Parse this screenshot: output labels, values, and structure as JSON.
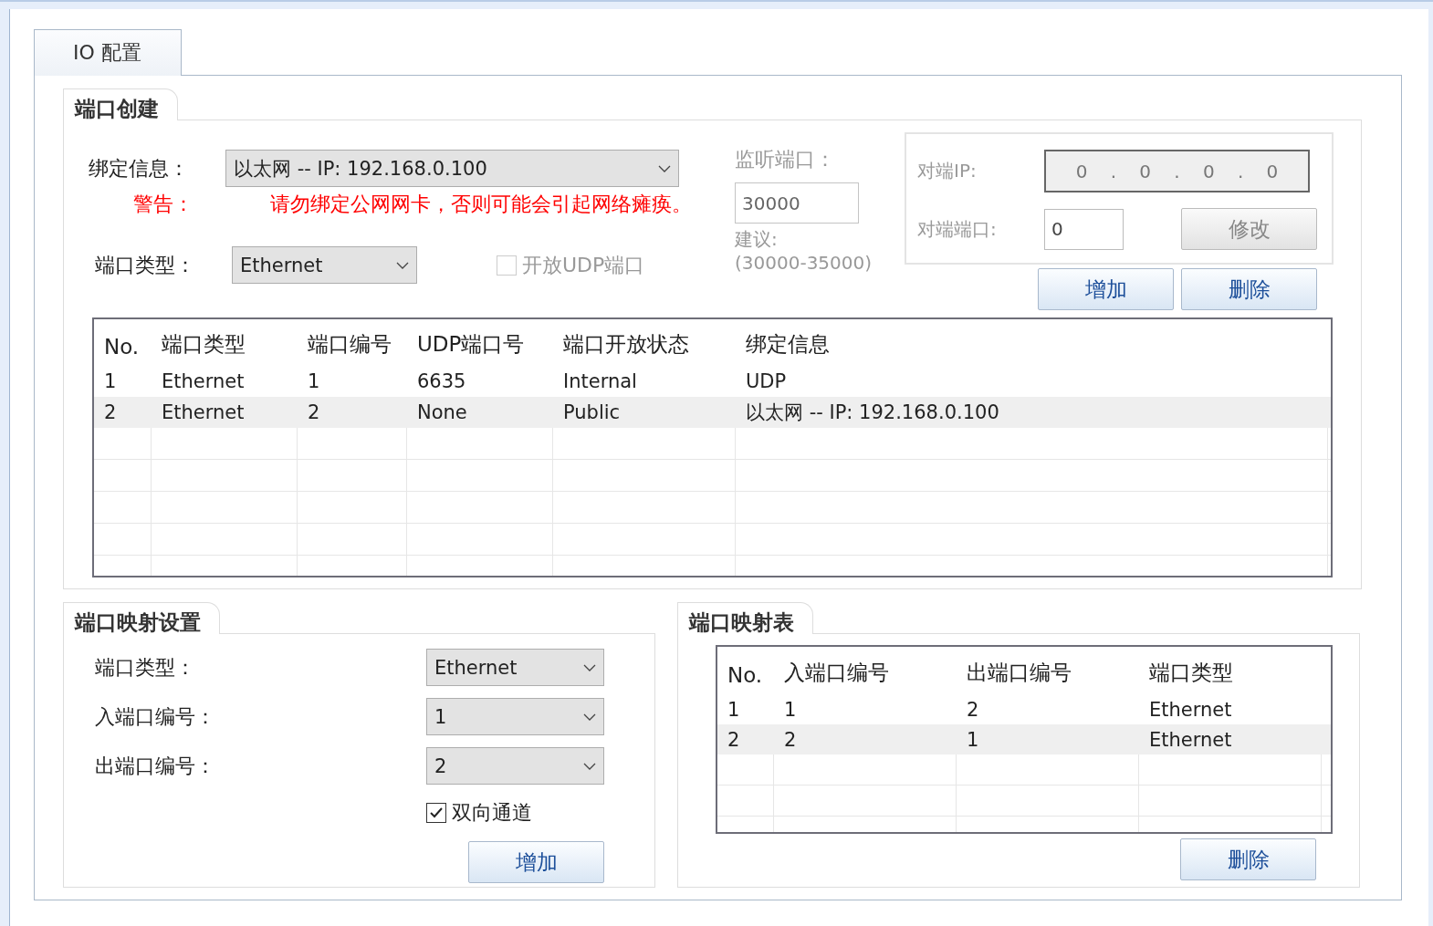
{
  "tabs": [
    {
      "label": "IO 配置",
      "selected": true
    }
  ],
  "port_creation": {
    "title": "端口创建",
    "binding": {
      "label": "绑定信息：",
      "value": "以太网 -- IP: 192.168.0.100"
    },
    "warning": {
      "label": "警告：",
      "text": "请勿绑定公网网卡，否则可能会引起网络瘫痪。"
    },
    "port_type": {
      "label": "端口类型：",
      "value": "Ethernet"
    },
    "open_udp": {
      "label": "开放UDP端口",
      "checked": false,
      "disabled": true
    },
    "listen_port": {
      "label": "监听端口：",
      "value": "30000",
      "hint": "建议:",
      "range": "(30000-35000)",
      "disabled": true
    },
    "peer": {
      "disabled": true,
      "ip_label": "对端IP:",
      "ip_octets": [
        "0",
        "0",
        "0",
        "0"
      ],
      "ip_separator": ".",
      "port_label": "对端端口:",
      "port_value": "0",
      "modify_button": "修改"
    },
    "buttons": [
      "增加",
      "删除"
    ],
    "table": {
      "columns": [
        "No.",
        "端口类型",
        "端口编号",
        "UDP端口号",
        "端口开放状态",
        "绑定信息"
      ],
      "rows": [
        {
          "cells": [
            "1",
            "Ethernet",
            "1",
            "6635",
            "Internal",
            "UDP"
          ],
          "selected": false
        },
        {
          "cells": [
            "2",
            "Ethernet",
            "2",
            "None",
            "Public",
            "以太网 -- IP: 192.168.0.100"
          ],
          "selected": true
        }
      ]
    }
  },
  "port_mapping_settings": {
    "title": "端口映射设置",
    "fields": [
      {
        "label": "端口类型：",
        "value": "Ethernet"
      },
      {
        "label": "入端口编号：",
        "value": "1"
      },
      {
        "label": "出端口编号：",
        "value": "2"
      }
    ],
    "bidirectional": {
      "label": "双向通道",
      "checked": true
    },
    "add_button": "增加"
  },
  "port_mapping_table": {
    "title": "端口映射表",
    "table": {
      "columns": [
        "No.",
        "入端口编号",
        "出端口编号",
        "端口类型"
      ],
      "rows": [
        {
          "cells": [
            "1",
            "1",
            "2",
            "Ethernet"
          ],
          "selected": false
        },
        {
          "cells": [
            "2",
            "2",
            "1",
            "Ethernet"
          ],
          "selected": true
        }
      ]
    },
    "delete_button": "删除"
  }
}
